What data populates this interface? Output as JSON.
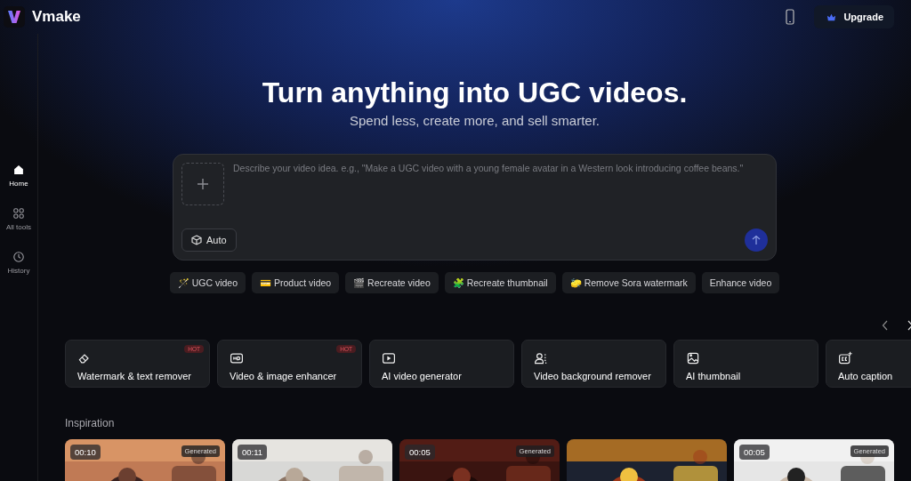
{
  "brand": {
    "name": "Vmake"
  },
  "header": {
    "upgrade": "Upgrade"
  },
  "sidebar": {
    "items": [
      {
        "label": "Home",
        "selected": true
      },
      {
        "label": "All tools",
        "selected": false
      },
      {
        "label": "History",
        "selected": false
      }
    ]
  },
  "hero": {
    "title": "Turn anything into UGC videos.",
    "subtitle": "Spend less, create more, and sell smarter."
  },
  "prompt": {
    "placeholder": "Describe your video idea. e.g., \"Make a UGC video with a young female avatar in a Western look introducing coffee beans.\"",
    "mode": "Auto"
  },
  "quick_actions": [
    {
      "label": "UGC video",
      "emoji": "🪄"
    },
    {
      "label": "Product video",
      "emoji": "💳"
    },
    {
      "label": "Recreate video",
      "emoji": "🎬"
    },
    {
      "label": "Recreate thumbnail",
      "emoji": "🧩"
    },
    {
      "label": "Remove Sora watermark",
      "emoji": "🧽"
    },
    {
      "label": "Enhance video"
    }
  ],
  "tools": [
    {
      "label": "Watermark & text remover",
      "badge": "HOT"
    },
    {
      "label": "Video & image enhancer",
      "badge": "HOT"
    },
    {
      "label": "AI video generator"
    },
    {
      "label": "Video background remover"
    },
    {
      "label": "AI thumbnail"
    },
    {
      "label": "Auto caption"
    }
  ],
  "inspiration": {
    "title": "Inspiration",
    "items": [
      {
        "kind": "picture",
        "duration": "00:10",
        "tag": "Generated"
      },
      {
        "kind": "picture",
        "duration": "00:11"
      },
      {
        "kind": "picture",
        "duration": "00:05",
        "tag": "Generated"
      },
      {
        "kind": "picture"
      },
      {
        "kind": "picture",
        "duration": "00:05",
        "tag": "Generated"
      }
    ]
  }
}
